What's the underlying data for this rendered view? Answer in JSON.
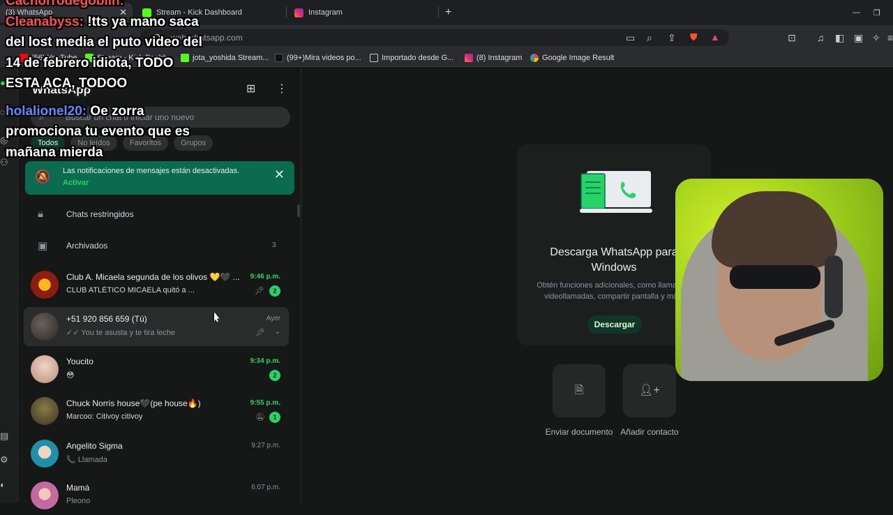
{
  "browser": {
    "tabs": [
      {
        "title": "(3) WhatsApp",
        "color": "#25d366"
      },
      {
        "title": "Stream - Kick Dashboard",
        "color": "#53fc18"
      },
      {
        "title": "Instagram",
        "color": "#e1306c"
      }
    ],
    "new_tab_label": "+",
    "close_label": "✕",
    "url": "web.whatsapp.com",
    "bookmarks": [
      {
        "title": "(56) YouTube",
        "color": "#ff0000"
      },
      {
        "title": "Stream - Kick Dashb...",
        "color": "#53fc18"
      },
      {
        "title": "jota_yoshida Stream...",
        "color": "#53fc18"
      },
      {
        "title": "(99+)Mira videos po...",
        "color": "#111111"
      },
      {
        "title": "Importado desde G...",
        "color": "#c9cbcd"
      },
      {
        "title": "(8) Instagram",
        "color": "#e1306c"
      },
      {
        "title": "Google Image Result",
        "color": "#4285f4"
      }
    ]
  },
  "sidebar": {
    "title": "WhatsApp",
    "search_placeholder": "Buscar un chat o iniciar uno nuevo",
    "filters": [
      "Todos",
      "No leídos",
      "Favoritos",
      "Grupos"
    ],
    "notification": {
      "text": "Las notificaciones de mensajes están desactivadas.",
      "action": "Activar"
    },
    "restricted_label": "Chats restringidos",
    "archived_label": "Archivados",
    "archived_count": "3",
    "chats": [
      {
        "name": "Club A. Micaela segunda de los olivos 💛🖤 ...",
        "preview": "CLUB ATLÉTICO MICAELA quitó a ...",
        "time": "9:46 p.m.",
        "badge": "2",
        "pinned": true,
        "unread": true,
        "avatar": "#8c1d10"
      },
      {
        "name": "+51 920 856 659 (Tú)",
        "preview": "✓✓ You te asusta y te tira leche",
        "time": "Ayer",
        "badge": "",
        "pinned": true,
        "unread": false,
        "avatar": "#4a4340"
      },
      {
        "name": "Youcito",
        "preview": "😳",
        "time": "9:34 p.m.",
        "badge": "2",
        "pinned": false,
        "unread": true,
        "avatar": "#d8b9a8"
      },
      {
        "name": "Chuck Norris house🖤(pe house🔥)",
        "preview": "Marcoo: Citivoy citivoy",
        "time": "9:55 p.m.",
        "badge": "1",
        "pinned": false,
        "muted": true,
        "unread": true,
        "avatar": "#5a5030"
      },
      {
        "name": "Angelito Sigma",
        "preview": "📞 Llamada",
        "time": "9:27 p.m.",
        "badge": "",
        "pinned": false,
        "unread": false,
        "avatar": "#1e90a8"
      },
      {
        "name": "Mamá",
        "preview": "Pleono",
        "time": "6:07 p.m.",
        "badge": "",
        "pinned": false,
        "unread": false,
        "avatar": "#c46aa0"
      }
    ]
  },
  "main": {
    "heading": "Descarga WhatsApp para\nWindows",
    "description": "Obtén funciones adicionales, como llamadas,\nvideollamadas, compartir pantalla y más.",
    "download_label": "Descargar",
    "actions": [
      {
        "label": "Enviar documento",
        "icon": "document-icon"
      },
      {
        "label": "Añadir contacto",
        "icon": "add-contact-icon"
      }
    ]
  },
  "chat_overlay": [
    {
      "user": "Cachorrodegoblin:",
      "message": "",
      "user_color": "red"
    },
    {
      "user": "Cleanabyss:",
      "message": " !tts ya mano saca",
      "user_color": "red"
    },
    {
      "user": "",
      "message": "del lost media el puto video del",
      "user_color": ""
    },
    {
      "user": "",
      "message": "14 de febrero idiota, TODO",
      "user_color": ""
    },
    {
      "user": "",
      "message": "ESTA ACA, TODOO",
      "user_color": ""
    },
    {
      "user": "holalionel20:",
      "message": " Oe zorra",
      "user_color": "blue"
    },
    {
      "user": "",
      "message": "promociona tu evento que es",
      "user_color": ""
    },
    {
      "user": "",
      "message": "mañana mierda",
      "user_color": ""
    }
  ],
  "colors": {
    "accent": "#25d366",
    "background": "#161717",
    "panel": "#1d1f1f"
  }
}
